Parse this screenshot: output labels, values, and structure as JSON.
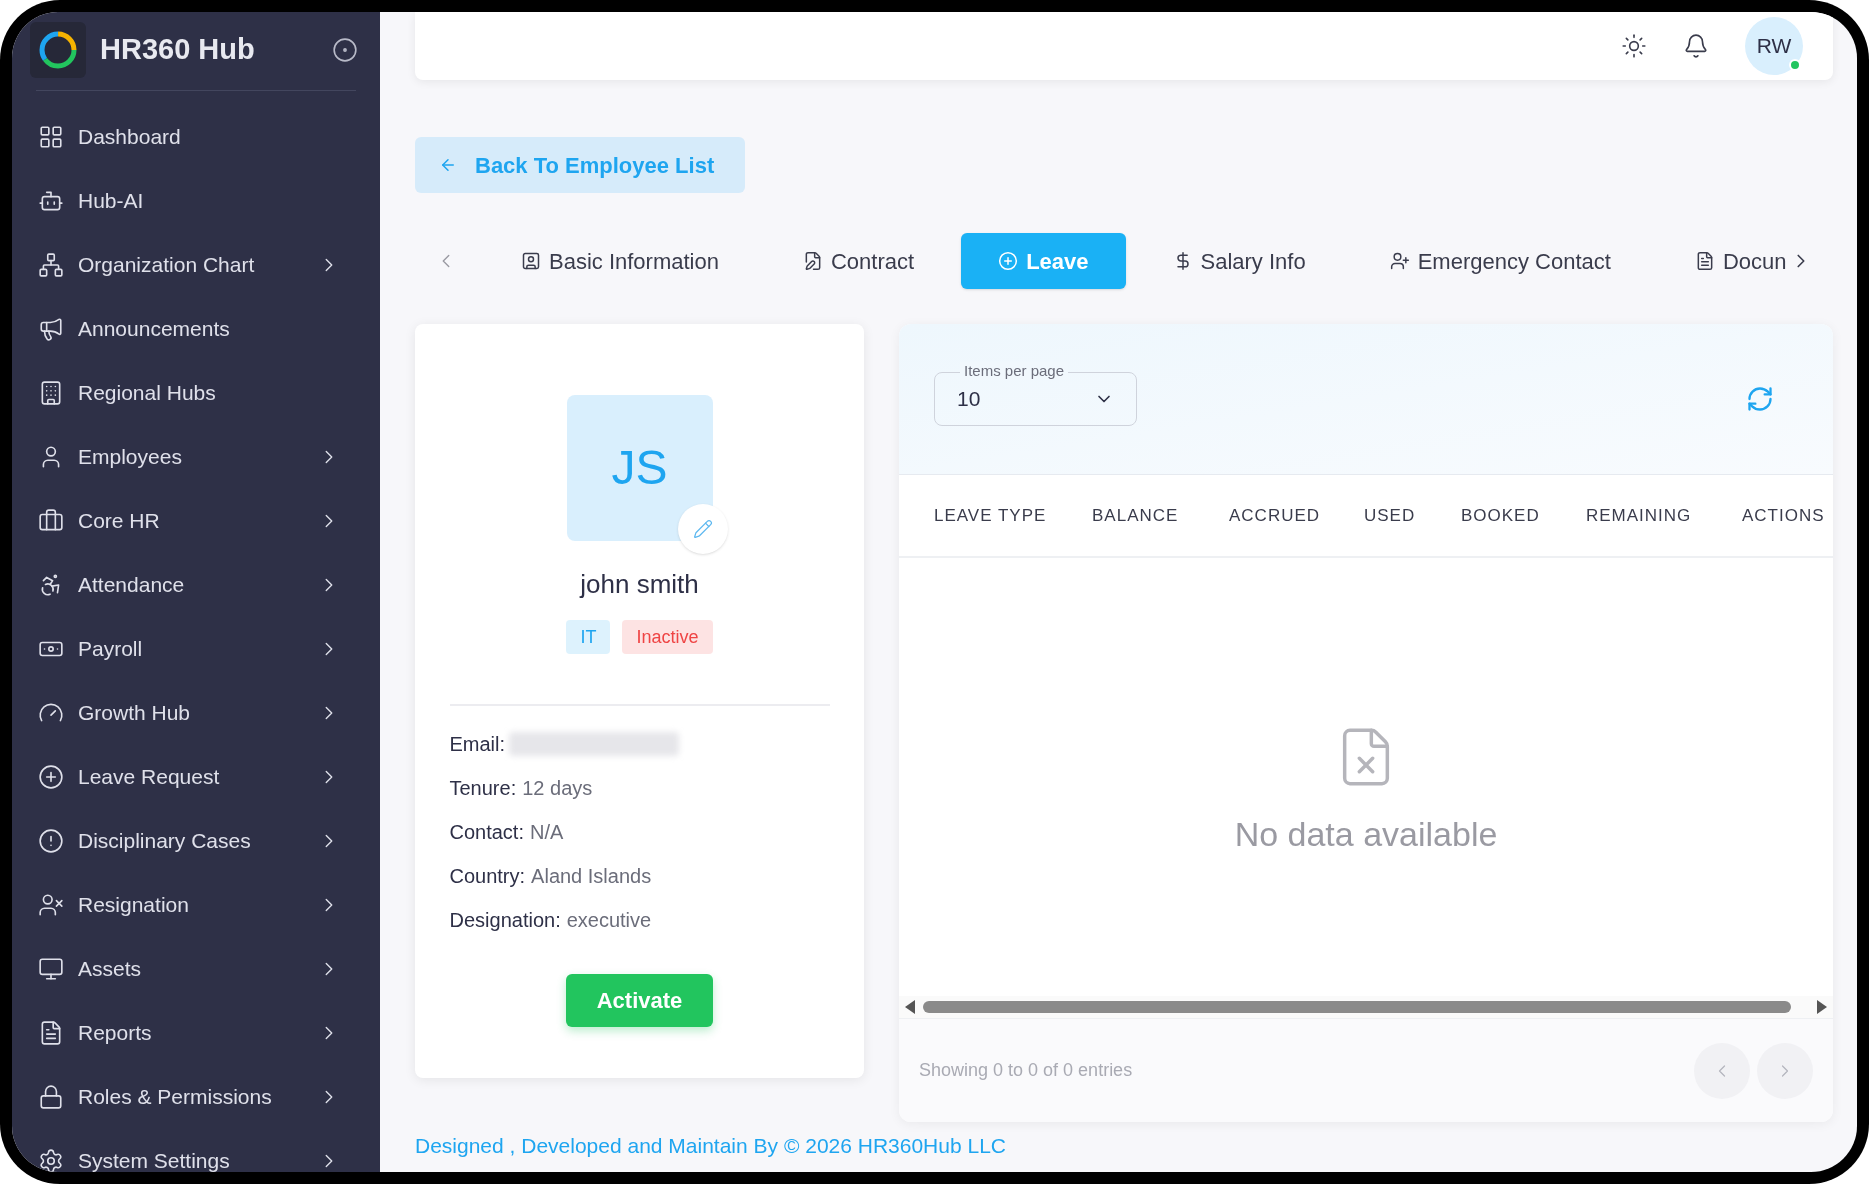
{
  "sidebar": {
    "brand": "HR360 Hub",
    "items": [
      {
        "label": "Dashboard",
        "expandable": false
      },
      {
        "label": "Hub-AI",
        "expandable": false
      },
      {
        "label": "Organization Chart",
        "expandable": true
      },
      {
        "label": "Announcements",
        "expandable": false
      },
      {
        "label": "Regional Hubs",
        "expandable": false
      },
      {
        "label": "Employees",
        "expandable": true
      },
      {
        "label": "Core HR",
        "expandable": true
      },
      {
        "label": "Attendance",
        "expandable": true
      },
      {
        "label": "Payroll",
        "expandable": true
      },
      {
        "label": "Growth Hub",
        "expandable": true
      },
      {
        "label": "Leave Request",
        "expandable": true
      },
      {
        "label": "Disciplinary Cases",
        "expandable": true
      },
      {
        "label": "Resignation",
        "expandable": true
      },
      {
        "label": "Assets",
        "expandable": true
      },
      {
        "label": "Reports",
        "expandable": true
      },
      {
        "label": "Roles & Permissions",
        "expandable": true
      },
      {
        "label": "System Settings",
        "expandable": true
      }
    ]
  },
  "header": {
    "avatar": {
      "initials": "RW",
      "online": true
    }
  },
  "back_button": "Back To Employee List",
  "tabs": [
    {
      "label": "Basic Information",
      "selected": false
    },
    {
      "label": "Contract",
      "selected": false
    },
    {
      "label": "Leave",
      "selected": true
    },
    {
      "label": "Salary Info",
      "selected": false
    },
    {
      "label": "Emergency Contact",
      "selected": false
    },
    {
      "label": "Docun",
      "selected": false
    }
  ],
  "profile": {
    "initials": "JS",
    "name": "john smith",
    "tags": [
      {
        "label": "IT",
        "color": "#1ea5f0"
      },
      {
        "label": "Inactive",
        "color": "#ef4444"
      }
    ],
    "details": [
      {
        "kind": "blurred",
        "label": "Email:"
      },
      {
        "kind": "text",
        "label": "Tenure:",
        "value": "12 days"
      },
      {
        "kind": "text",
        "label": "Contact:",
        "value": "N/A"
      },
      {
        "kind": "text",
        "label": "Country:",
        "value": "Aland Islands"
      },
      {
        "kind": "text",
        "label": "Designation:",
        "value": "executive"
      }
    ],
    "button": "Activate"
  },
  "leave_table": {
    "items_per_page": {
      "label": "Items per page",
      "value": "10"
    },
    "columns": [
      "LEAVE TYPE",
      "BALANCE",
      "ACCRUED",
      "USED",
      "BOOKED",
      "REMAINING",
      "ACTIONS"
    ],
    "empty_text": "No data available",
    "footer_text": "Showing 0 to 0 of 0 entries",
    "pagination": {
      "previous_disabled": true,
      "next_disabled": true
    }
  },
  "footer": "Designed , Developed and Maintain By © 2026 HR360Hub LLC"
}
